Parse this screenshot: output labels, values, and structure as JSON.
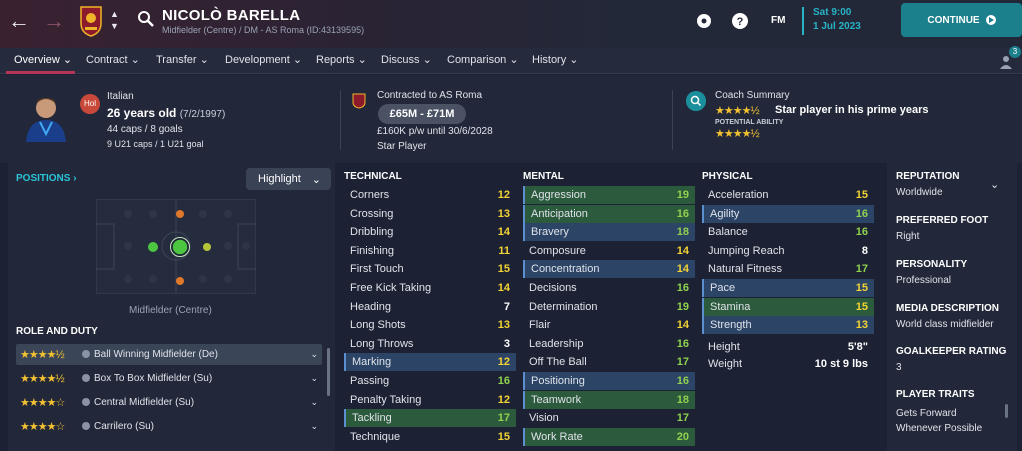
{
  "header": {
    "player_name": "NICOLÒ BARELLA",
    "player_subtitle": "Midfielder (Centre) / DM - AS Roma (ID:43139595)",
    "fm_label": "FM",
    "date_day": "Sat 9:00",
    "date_full": "1 Jul 2023",
    "continue_label": "CONTINUE",
    "notification_count": "3"
  },
  "tabs": [
    {
      "label": "Overview"
    },
    {
      "label": "Contract"
    },
    {
      "label": "Transfer"
    },
    {
      "label": "Development"
    },
    {
      "label": "Reports"
    },
    {
      "label": "Discuss"
    },
    {
      "label": "Comparison"
    },
    {
      "label": "History"
    }
  ],
  "profile": {
    "nationality": "Italian",
    "nation_code": "Hol",
    "age": "26 years old",
    "dob": "(7/2/1997)",
    "caps": "44 caps / 8 goals",
    "u21": "9 U21 caps / 1 U21 goal"
  },
  "contract": {
    "title": "Contracted to AS Roma",
    "value": "£65M - £71M",
    "wage": "£160K p/w until 30/6/2028",
    "status": "Star Player"
  },
  "coach": {
    "title": "Coach Summary",
    "summary": "Star player in his prime years",
    "potential_label": "POTENTIAL ABILITY",
    "current_stars": 4.5,
    "potential_stars": 4.5
  },
  "positions": {
    "label": "POSITIONS",
    "highlight_label": "Highlight",
    "position_label": "Midfielder (Centre)"
  },
  "role_duty": {
    "title": "ROLE AND DUTY",
    "roles": [
      {
        "stars": "★★★★½",
        "name": "Ball Winning Midfielder (De)"
      },
      {
        "stars": "★★★★½",
        "name": "Box To Box Midfielder (Su)"
      },
      {
        "stars": "★★★★☆",
        "name": "Central Midfielder (Su)"
      },
      {
        "stars": "★★★★☆",
        "name": "Carrilero (Su)"
      }
    ]
  },
  "technical": {
    "title": "TECHNICAL",
    "attrs": [
      {
        "name": "Corners",
        "value": "12"
      },
      {
        "name": "Crossing",
        "value": "13"
      },
      {
        "name": "Dribbling",
        "value": "14"
      },
      {
        "name": "Finishing",
        "value": "11"
      },
      {
        "name": "First Touch",
        "value": "15"
      },
      {
        "name": "Free Kick Taking",
        "value": "14"
      },
      {
        "name": "Heading",
        "value": "7"
      },
      {
        "name": "Long Shots",
        "value": "13"
      },
      {
        "name": "Long Throws",
        "value": "3"
      },
      {
        "name": "Marking",
        "value": "12"
      },
      {
        "name": "Passing",
        "value": "16"
      },
      {
        "name": "Penalty Taking",
        "value": "12"
      },
      {
        "name": "Tackling",
        "value": "17"
      },
      {
        "name": "Technique",
        "value": "15"
      }
    ]
  },
  "mental": {
    "title": "MENTAL",
    "attrs": [
      {
        "name": "Aggression",
        "value": "19"
      },
      {
        "name": "Anticipation",
        "value": "16"
      },
      {
        "name": "Bravery",
        "value": "18"
      },
      {
        "name": "Composure",
        "value": "14"
      },
      {
        "name": "Concentration",
        "value": "14"
      },
      {
        "name": "Decisions",
        "value": "16"
      },
      {
        "name": "Determination",
        "value": "19"
      },
      {
        "name": "Flair",
        "value": "14"
      },
      {
        "name": "Leadership",
        "value": "16"
      },
      {
        "name": "Off The Ball",
        "value": "17"
      },
      {
        "name": "Positioning",
        "value": "16"
      },
      {
        "name": "Teamwork",
        "value": "18"
      },
      {
        "name": "Vision",
        "value": "17"
      },
      {
        "name": "Work Rate",
        "value": "20"
      }
    ]
  },
  "physical": {
    "title": "PHYSICAL",
    "attrs": [
      {
        "name": "Acceleration",
        "value": "15"
      },
      {
        "name": "Agility",
        "value": "16"
      },
      {
        "name": "Balance",
        "value": "16"
      },
      {
        "name": "Jumping Reach",
        "value": "8"
      },
      {
        "name": "Natural Fitness",
        "value": "17"
      },
      {
        "name": "Pace",
        "value": "15"
      },
      {
        "name": "Stamina",
        "value": "15"
      },
      {
        "name": "Strength",
        "value": "13"
      }
    ],
    "height_label": "Height",
    "height": "5'8\"",
    "weight_label": "Weight",
    "weight": "10 st 9 lbs"
  },
  "sidebar": {
    "reputation_label": "REPUTATION",
    "reputation": "Worldwide",
    "foot_label": "PREFERRED FOOT",
    "foot": "Right",
    "personality_label": "PERSONALITY",
    "personality": "Professional",
    "media_label": "MEDIA DESCRIPTION",
    "media": "World class midfielder",
    "gk_label": "GOALKEEPER RATING",
    "gk": "3",
    "traits_label": "PLAYER TRAITS",
    "trait1": "Gets Forward",
    "trait2": "Whenever Possible"
  },
  "colors": {
    "accent": "#27b3c6",
    "continue_bg": "#1b7f8c",
    "star": "#f2c230",
    "high": "#8fd14f",
    "mid": "#f2d335",
    "low": "#ffffff"
  }
}
